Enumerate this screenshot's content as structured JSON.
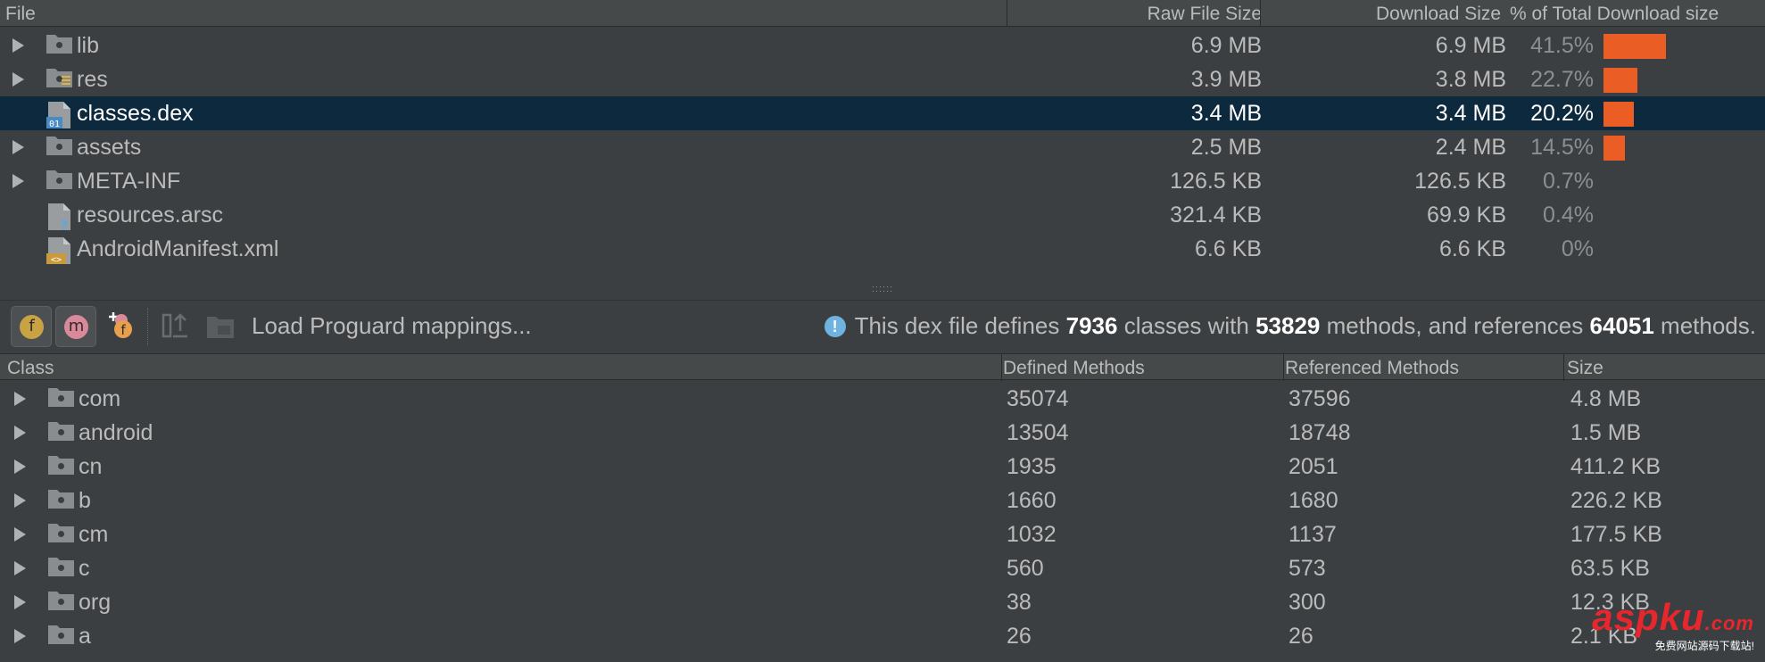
{
  "file_table": {
    "headers": {
      "file": "File",
      "raw_size": "Raw File Size",
      "download_size": "Download Size",
      "pct": "% of Total Download size"
    },
    "rows": [
      {
        "name": "lib",
        "raw": "6.9 MB",
        "download": "6.9 MB",
        "pct": "41.5%",
        "pct_value": 41.5,
        "type": "folder",
        "expandable": true
      },
      {
        "name": "res",
        "raw": "3.9 MB",
        "download": "3.8 MB",
        "pct": "22.7%",
        "pct_value": 22.7,
        "type": "folder-res",
        "expandable": true
      },
      {
        "name": "classes.dex",
        "raw": "3.4 MB",
        "download": "3.4 MB",
        "pct": "20.2%",
        "pct_value": 20.2,
        "type": "dex-file",
        "expandable": false,
        "selected": true
      },
      {
        "name": "assets",
        "raw": "2.5 MB",
        "download": "2.4 MB",
        "pct": "14.5%",
        "pct_value": 14.5,
        "type": "folder",
        "expandable": true
      },
      {
        "name": "META-INF",
        "raw": "126.5 KB",
        "download": "126.5 KB",
        "pct": "0.7%",
        "pct_value": 0.7,
        "type": "folder",
        "expandable": true
      },
      {
        "name": "resources.arsc",
        "raw": "321.4 KB",
        "download": "69.9 KB",
        "pct": "0.4%",
        "pct_value": 0.4,
        "type": "unknown-file",
        "expandable": false
      },
      {
        "name": "AndroidManifest.xml",
        "raw": "6.6 KB",
        "download": "6.6 KB",
        "pct": "0%",
        "pct_value": 0,
        "type": "xml-file",
        "expandable": false
      }
    ]
  },
  "toolbar": {
    "fields_icon_letter": "f",
    "methods_icon_letter": "m",
    "load_proguard_label": "Load Proguard mappings...",
    "info": {
      "prefix": "This dex file defines",
      "classes_count": "7936",
      "mid1": "classes with",
      "methods_count": "53829",
      "mid2": "methods, and references",
      "refs_count": "64051",
      "suffix": "methods."
    }
  },
  "class_table": {
    "headers": {
      "class": "Class",
      "defined": "Defined Methods",
      "referenced": "Referenced Methods",
      "size": "Size"
    },
    "rows": [
      {
        "name": "com",
        "defined": "35074",
        "referenced": "37596",
        "size": "4.8 MB"
      },
      {
        "name": "android",
        "defined": "13504",
        "referenced": "18748",
        "size": "1.5 MB"
      },
      {
        "name": "cn",
        "defined": "1935",
        "referenced": "2051",
        "size": "411.2 KB"
      },
      {
        "name": "b",
        "defined": "1660",
        "referenced": "1680",
        "size": "226.2 KB"
      },
      {
        "name": "cm",
        "defined": "1032",
        "referenced": "1137",
        "size": "177.5 KB"
      },
      {
        "name": "c",
        "defined": "560",
        "referenced": "573",
        "size": "63.5 KB"
      },
      {
        "name": "org",
        "defined": "38",
        "referenced": "300",
        "size": "12.3 KB"
      },
      {
        "name": "a",
        "defined": "26",
        "referenced": "26",
        "size": "2.1 KB"
      }
    ]
  },
  "watermark": {
    "main": "aspku",
    "suffix": ".com",
    "sub": "免费网站源码下载站!"
  },
  "colors": {
    "background": "#3c3f41",
    "selection": "#0d293e",
    "bar": "#ea5e26",
    "info_icon": "#6fb3e0",
    "fields_badge": "#c9a244",
    "methods_badge": "#d98a9a"
  }
}
